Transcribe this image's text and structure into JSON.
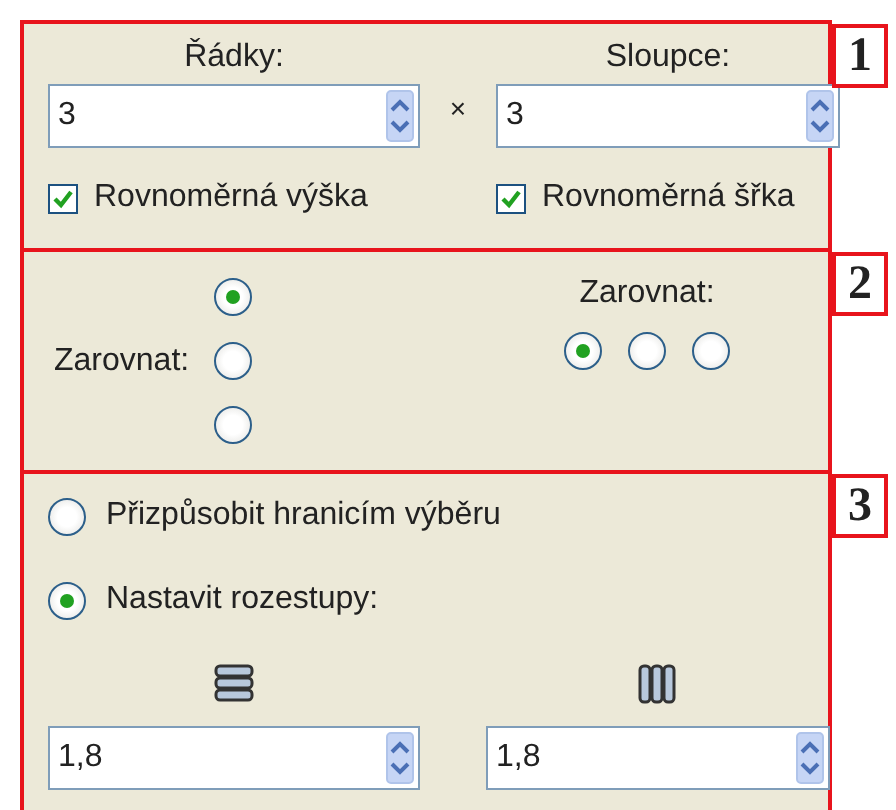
{
  "sections": [
    {
      "number": "1",
      "fields": [
        {
          "label": "Řádky:",
          "value": "3"
        },
        {
          "label": "Sloupce:",
          "value": "3"
        }
      ],
      "separator": "×",
      "checkboxes": [
        {
          "label": "Rovnoměrná výška",
          "checked": true
        },
        {
          "label": "Rovnoměrná šřka",
          "checked": true
        }
      ]
    },
    {
      "number": "2",
      "vertical": {
        "label": "Zarovnat:",
        "options": [
          {
            "selected": true
          },
          {
            "selected": false
          },
          {
            "selected": false
          }
        ]
      },
      "horizontal": {
        "label": "Zarovnat:",
        "options": [
          {
            "selected": true
          },
          {
            "selected": false
          },
          {
            "selected": false
          }
        ]
      }
    },
    {
      "number": "3",
      "modes": [
        {
          "label": "Přizpůsobit hranicím výběru",
          "selected": false
        },
        {
          "label": "Nastavit rozestupy:",
          "selected": true
        }
      ],
      "spacing": [
        {
          "value": "1,8"
        },
        {
          "value": "1,8"
        }
      ]
    }
  ]
}
